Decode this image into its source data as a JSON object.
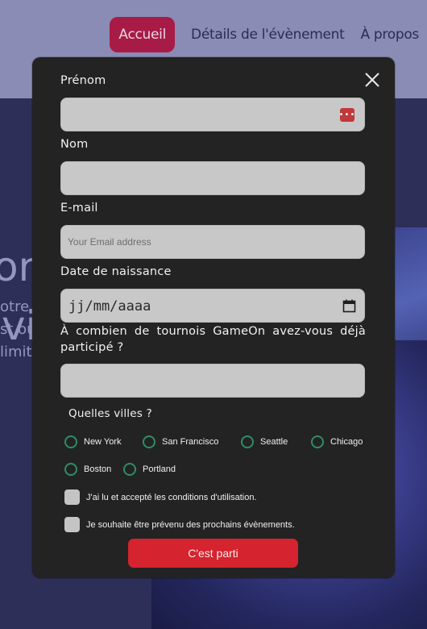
{
  "nav": {
    "items": [
      "Accueil",
      "Détails de l'évènement",
      "À propos"
    ]
  },
  "hero": {
    "line1": "or",
    "line2": "vi",
    "small": [
      "otre",
      "st ou",
      "limit"
    ]
  },
  "form": {
    "first_name_label": "Prénom",
    "last_name_label": "Nom",
    "email_label": "E-mail",
    "email_placeholder": "Your Email address",
    "birthdate_label": "Date de naissance",
    "birthdate_placeholder": "jj/mm/aaaa",
    "tournaments_label": "À combien de tournois GameOn avez-vous déjà participé ?",
    "cities_label": "Quelles villes ?",
    "cities": [
      "New York",
      "San Francisco",
      "Seattle",
      "Chicago",
      "Boston",
      "Portland"
    ],
    "terms_label": "J'ai lu et accepté les conditions d'utilisation.",
    "newsletter_label": "Je souhaite être prévenu des prochains évènements.",
    "submit_label": "C'est parti"
  },
  "colors": {
    "brand": "#d5232f",
    "nav_active": "#a81b46",
    "radio_border": "#2f8e63",
    "modal_bg": "#232323"
  }
}
